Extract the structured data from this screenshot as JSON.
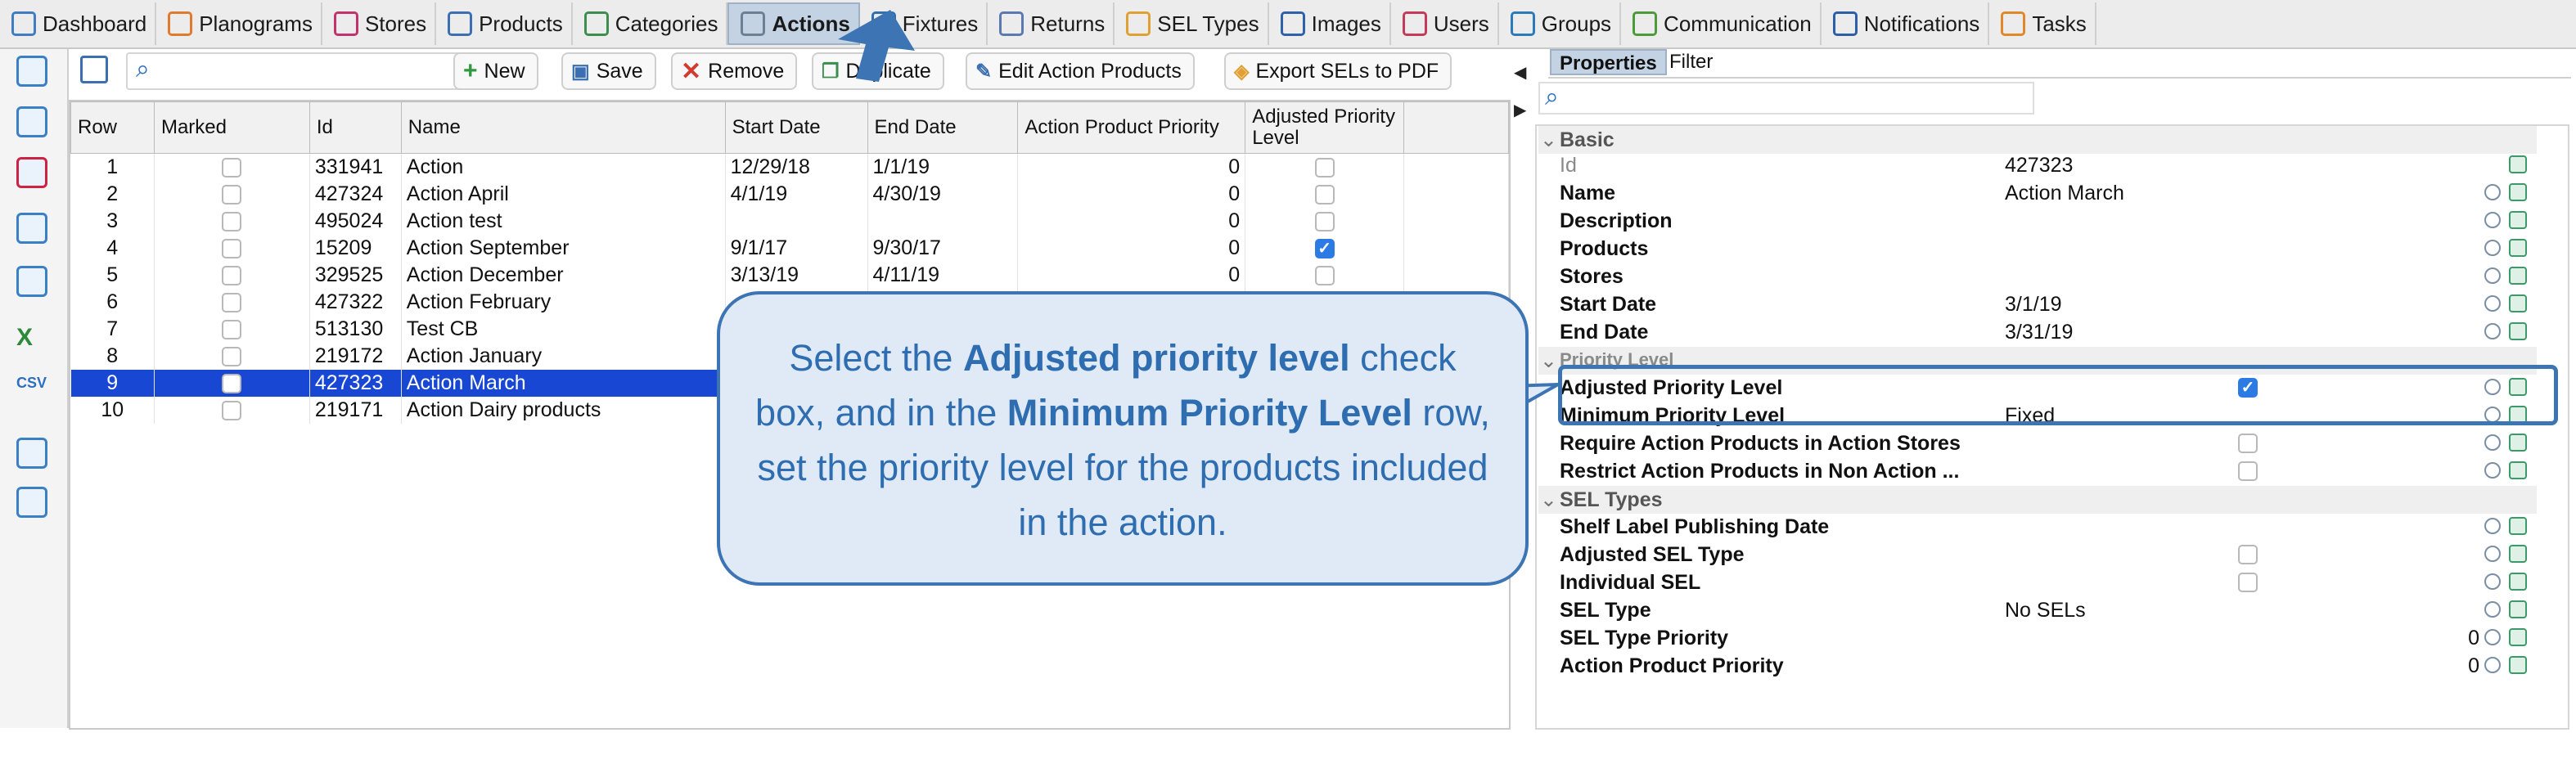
{
  "nav_tabs": [
    {
      "label": "Dashboard",
      "color": "#3f7cc0"
    },
    {
      "label": "Planograms",
      "color": "#e07a2f"
    },
    {
      "label": "Stores",
      "color": "#c2336e"
    },
    {
      "label": "Products",
      "color": "#3b6fb2"
    },
    {
      "label": "Categories",
      "color": "#3c8e4f"
    },
    {
      "label": "Actions",
      "color": "#6b7f95"
    },
    {
      "label": "Fixtures",
      "color": "#2f6fb0"
    },
    {
      "label": "Returns",
      "color": "#5b79b0"
    },
    {
      "label": "SEL Types",
      "color": "#e0a033"
    },
    {
      "label": "Images",
      "color": "#2d62a8"
    },
    {
      "label": "Users",
      "color": "#c53a5a"
    },
    {
      "label": "Groups",
      "color": "#2b7bb8"
    },
    {
      "label": "Communication",
      "color": "#4c9b38"
    },
    {
      "label": "Notifications",
      "color": "#2b5fa8"
    },
    {
      "label": "Tasks",
      "color": "#e0892a"
    }
  ],
  "active_tab": "Actions",
  "toolbar": {
    "search_placeholder": "",
    "new_label": "New",
    "save_label": "Save",
    "remove_label": "Remove",
    "duplicate_label": "Duplicate",
    "edit_label": "Edit Action Products",
    "export_label": "Export SELs to PDF"
  },
  "table": {
    "columns": [
      "Row",
      "Marked",
      "Id",
      "Name",
      "Start Date",
      "End Date",
      "Action Product Priority",
      "Adjusted Priority Level"
    ],
    "rows": [
      {
        "row": "1",
        "marked": false,
        "id": "331941",
        "name": "Action",
        "start": "12/29/18",
        "end": "1/1/19",
        "priority": "0",
        "adjusted": false
      },
      {
        "row": "2",
        "marked": false,
        "id": "427324",
        "name": "Action April",
        "start": "4/1/19",
        "end": "4/30/19",
        "priority": "0",
        "adjusted": false
      },
      {
        "row": "3",
        "marked": false,
        "id": "495024",
        "name": "Action test",
        "start": "",
        "end": "",
        "priority": "0",
        "adjusted": false
      },
      {
        "row": "4",
        "marked": false,
        "id": "15209",
        "name": "Action September",
        "start": "9/1/17",
        "end": "9/30/17",
        "priority": "0",
        "adjusted": true
      },
      {
        "row": "5",
        "marked": false,
        "id": "329525",
        "name": "Action December",
        "start": "3/13/19",
        "end": "4/11/19",
        "priority": "0",
        "adjusted": false
      },
      {
        "row": "6",
        "marked": false,
        "id": "427322",
        "name": "Action February",
        "start": "",
        "end": "",
        "priority": "",
        "adjusted": false
      },
      {
        "row": "7",
        "marked": false,
        "id": "513130",
        "name": "Test CB",
        "start": "",
        "end": "",
        "priority": "",
        "adjusted": false
      },
      {
        "row": "8",
        "marked": false,
        "id": "219172",
        "name": "Action January",
        "start": "",
        "end": "",
        "priority": "",
        "adjusted": false
      },
      {
        "row": "9",
        "marked": false,
        "id": "427323",
        "name": "Action March",
        "start": "",
        "end": "",
        "priority": "",
        "adjusted": false,
        "selected": true
      },
      {
        "row": "10",
        "marked": false,
        "id": "219171",
        "name": "Action Dairy products",
        "start": "",
        "end": "",
        "priority": "",
        "adjusted": false
      }
    ]
  },
  "right_panel": {
    "tab_properties": "Properties",
    "tab_filter": "Filter",
    "search_placeholder": "",
    "sections": {
      "basic": "Basic",
      "priority_level": "Priority Level",
      "sel_types": "SEL Types"
    },
    "props": {
      "id": {
        "name": "Id",
        "value": "427323"
      },
      "name": {
        "name": "Name",
        "value": "Action March"
      },
      "description": {
        "name": "Description",
        "value": ""
      },
      "products": {
        "name": "Products",
        "value": ""
      },
      "stores": {
        "name": "Stores",
        "value": ""
      },
      "start_date": {
        "name": "Start Date",
        "value": "3/1/19"
      },
      "end_date": {
        "name": "End Date",
        "value": "3/31/19"
      },
      "adjusted_priority": {
        "name": "Adjusted Priority Level",
        "checked": true
      },
      "minimum_priority": {
        "name": "Minimum Priority Level",
        "value": "Fixed"
      },
      "require_products": {
        "name": "Require Action Products in Action Stores",
        "checked": false
      },
      "restrict_products": {
        "name": "Restrict Action Products in Non Action ...",
        "checked": false
      },
      "shelf_label_date": {
        "name": "Shelf Label Publishing Date",
        "value": ""
      },
      "adjusted_sel": {
        "name": "Adjusted SEL Type",
        "checked": false
      },
      "individual_sel": {
        "name": "Individual SEL",
        "checked": false
      },
      "sel_type": {
        "name": "SEL Type",
        "value": "No SELs"
      },
      "sel_type_priority": {
        "name": "SEL Type Priority",
        "value": "0"
      },
      "action_product_priority": {
        "name": "Action Product Priority",
        "value": "0"
      }
    }
  },
  "callout": {
    "t1": "Select the ",
    "b1": "Adjusted priority level",
    "t2": " check box, and in the ",
    "b2": "Minimum Priority Level",
    "t3": " row, set the priority level for the products included in the action."
  },
  "colors": {
    "accent": "#3d74b4",
    "selection": "#1747d3",
    "checkbox": "#2c7be5"
  }
}
